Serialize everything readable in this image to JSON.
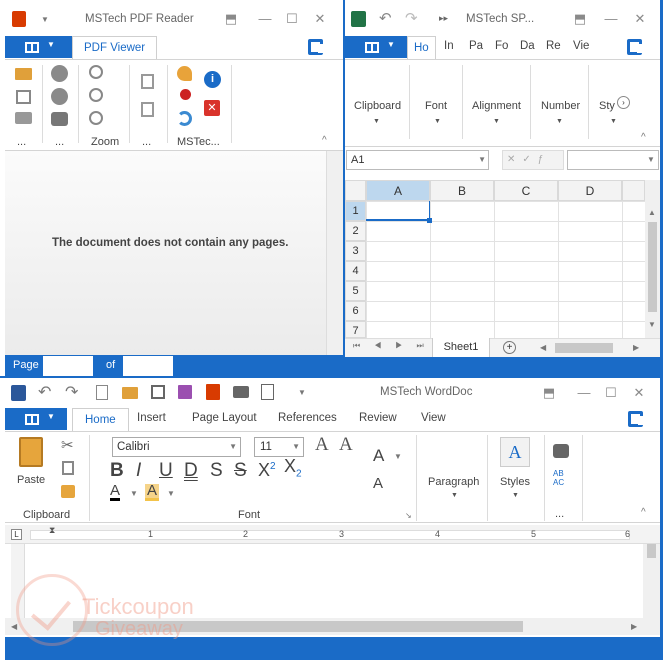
{
  "pdf": {
    "title": "MSTech PDF Reader",
    "tab_viewer": "PDF Viewer",
    "group_labels": [
      "...",
      "...",
      "Zoom",
      "...",
      "MSTec..."
    ],
    "empty_message": "The document does not contain any pages.",
    "status_page": "Page",
    "status_of": "of"
  },
  "sheet": {
    "title": "MSTech SP...",
    "tabs": [
      "Ho",
      "In",
      "Pa",
      "Fo",
      "Da",
      "Re",
      "Vie"
    ],
    "groups": [
      "Clipboard",
      "Font",
      "Alignment",
      "Number",
      "Sty"
    ],
    "name_box": "A1",
    "columns": [
      "A",
      "B",
      "C",
      "D"
    ],
    "rows": [
      "1",
      "2",
      "3",
      "4",
      "5",
      "6",
      "7"
    ],
    "sheet_tab": "Sheet1"
  },
  "word": {
    "title": "MSTech WordDoc",
    "tabs": [
      "Home",
      "Insert",
      "Page Layout",
      "References",
      "Review",
      "View"
    ],
    "paste": "Paste",
    "font_name": "Calibri",
    "font_size": "11",
    "group_clipboard": "Clipboard",
    "group_font": "Font",
    "paragraph": "Paragraph",
    "styles": "Styles",
    "more": "...",
    "ruler_numbers": [
      "1",
      "2",
      "3",
      "4",
      "5",
      "6"
    ],
    "format_buttons": [
      "B",
      "I",
      "U",
      "D",
      "S",
      "S",
      "X",
      "X"
    ],
    "superscript": "2",
    "subscript": "2",
    "find_replace_top": "AB",
    "find_replace_bottom": "AC"
  },
  "watermark": {
    "line1": "Tickcoupon",
    "line2": "Giveaway"
  },
  "colors": {
    "accent": "#1a6bc7",
    "pdf_red": "#d83b01",
    "excel_green": "#217346",
    "word_blue": "#2b579a"
  },
  "icons": [
    "pdf-app-icon",
    "excel-app-icon",
    "word-app-icon",
    "open-folder-icon",
    "arrow-up-icon",
    "arrow-down-icon",
    "zoom-out-icon",
    "zoom-in-icon",
    "key-icon",
    "info-icon",
    "close-icon",
    "paste-icon",
    "cut-icon",
    "copy-icon",
    "binoculars-icon"
  ]
}
